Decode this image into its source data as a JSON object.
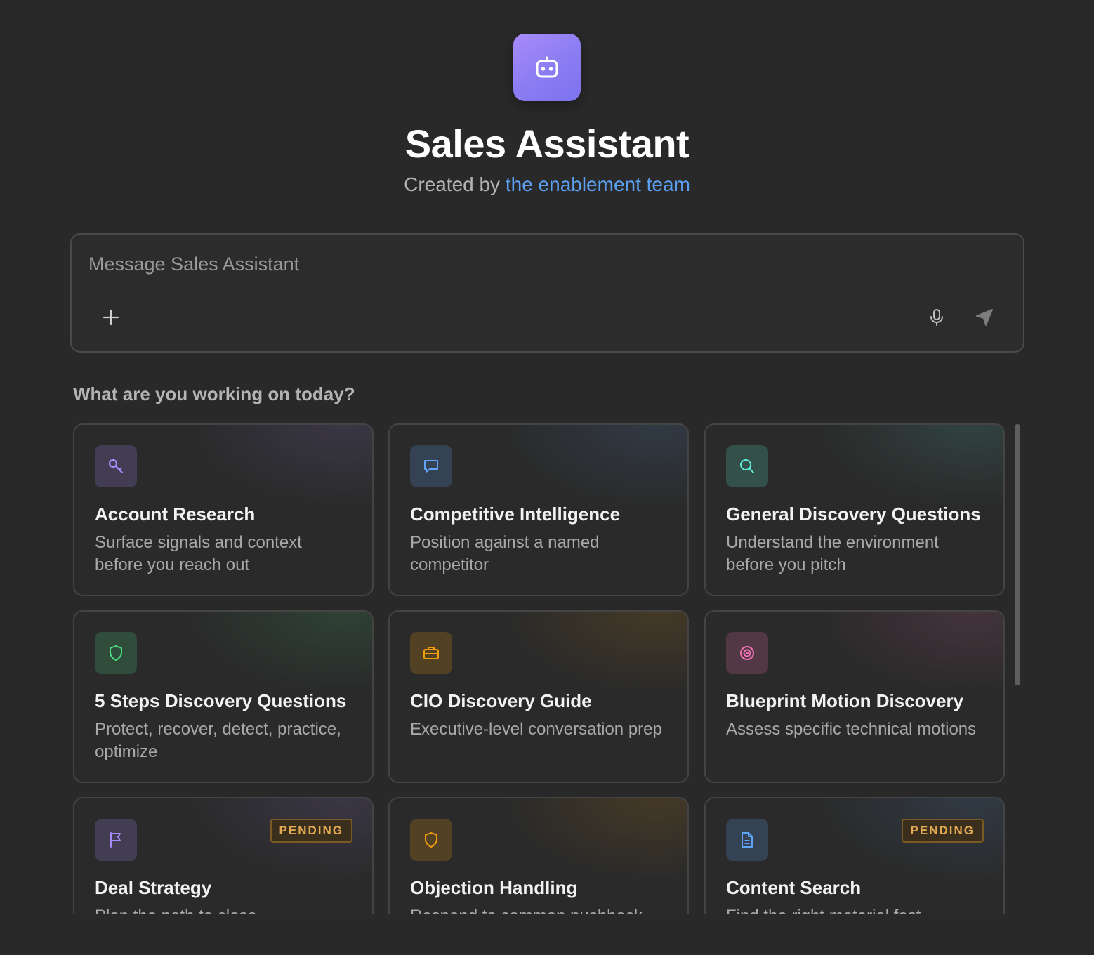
{
  "assistant": {
    "avatar_icon": "robot-icon",
    "name": "Sales Assistant",
    "created_by_prefix": "Created by",
    "created_by_link": "the enablement team"
  },
  "composer": {
    "placeholder": "Message Sales Assistant",
    "value": "",
    "add_icon": "plus-icon",
    "mic_icon": "microphone-icon",
    "send_icon": "send-icon"
  },
  "section": {
    "heading": "What are you working on today?"
  },
  "cards": [
    {
      "title": "Account Research",
      "desc": "Surface signals and context before you reach out",
      "icon": "key-icon",
      "accent": "#a78bfa",
      "badge": ""
    },
    {
      "title": "Competitive Intelligence",
      "desc": "Position against a named competitor",
      "icon": "chat-bubble-icon",
      "accent": "#60a5fa",
      "badge": ""
    },
    {
      "title": "General Discovery Questions",
      "desc": "Understand the environment before you pitch",
      "icon": "search-icon",
      "accent": "#5eead4",
      "badge": ""
    },
    {
      "title": "5 Steps Discovery Questions",
      "desc": "Protect, recover, detect, practice, optimize",
      "icon": "shield-icon",
      "accent": "#4ade80",
      "badge": ""
    },
    {
      "title": "CIO Discovery Guide",
      "desc": "Executive-level conversation prep",
      "icon": "briefcase-icon",
      "accent": "#f59e0b",
      "badge": ""
    },
    {
      "title": "Blueprint Motion Discovery",
      "desc": "Assess specific technical motions",
      "icon": "target-icon",
      "accent": "#f472b6",
      "badge": ""
    },
    {
      "title": "Deal Strategy",
      "desc": "Plan the path to close",
      "icon": "flag-icon",
      "accent": "#a78bfa",
      "badge": "PENDING"
    },
    {
      "title": "Objection Handling",
      "desc": "Respond to common pushback",
      "icon": "shield-icon",
      "accent": "#f59e0b",
      "badge": ""
    },
    {
      "title": "Content Search",
      "desc": "Find the right material fast",
      "icon": "document-icon",
      "accent": "#60a5fa",
      "badge": "PENDING"
    }
  ]
}
